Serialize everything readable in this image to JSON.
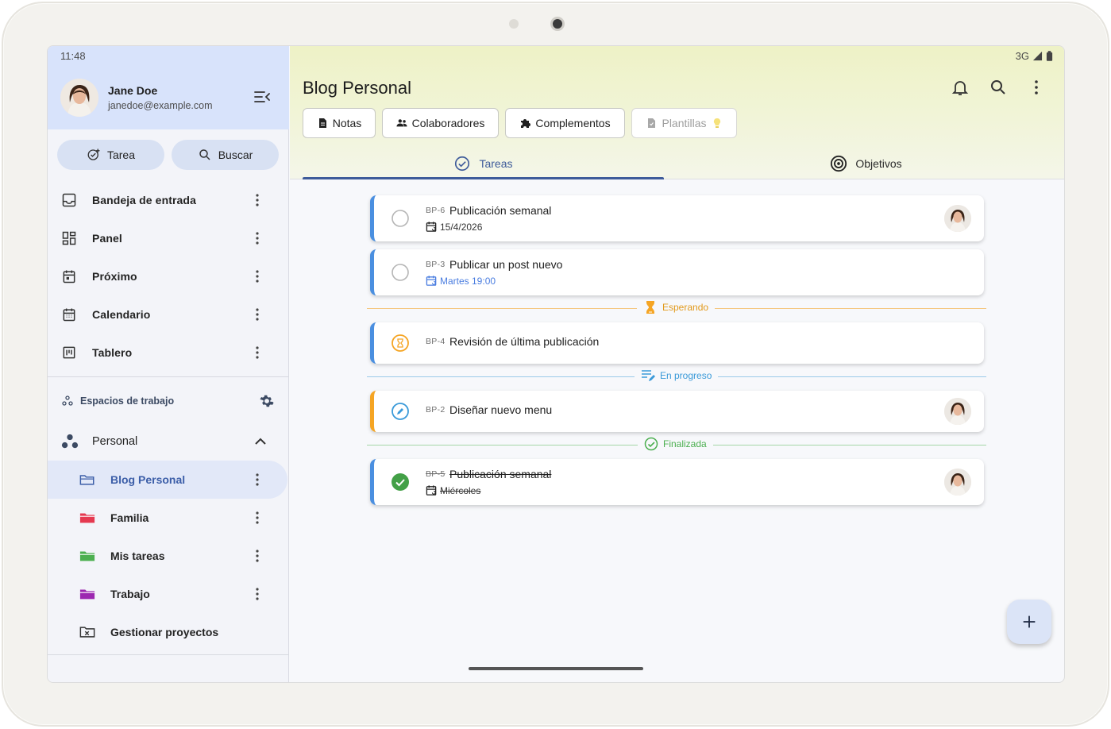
{
  "status_bar": {
    "time": "11:48",
    "network": "3G"
  },
  "user": {
    "name": "Jane Doe",
    "email": "janedoe@example.com"
  },
  "actions": {
    "task": "Tarea",
    "search": "Buscar"
  },
  "nav": [
    {
      "label": "Bandeja de entrada",
      "icon": "inbox-icon"
    },
    {
      "label": "Panel",
      "icon": "dashboard-icon"
    },
    {
      "label": "Próximo",
      "icon": "upcoming-icon"
    },
    {
      "label": "Calendario",
      "icon": "calendar-icon"
    },
    {
      "label": "Tablero",
      "icon": "board-icon"
    }
  ],
  "workspaces": {
    "header": "Espacios de trabajo",
    "current": "Personal"
  },
  "projects": [
    {
      "label": "Blog Personal",
      "color": "#3c5ea8",
      "active": true
    },
    {
      "label": "Familia",
      "color": "#e53950"
    },
    {
      "label": "Mis tareas",
      "color": "#4caf50"
    },
    {
      "label": "Trabajo",
      "color": "#9c27b0"
    }
  ],
  "manage_projects": "Gestionar proyectos",
  "header": {
    "title": "Blog Personal",
    "chips": [
      "Notas",
      "Colaboradores",
      "Complementos",
      "Plantillas"
    ],
    "tabs": [
      "Tareas",
      "Objetivos"
    ]
  },
  "tasks": [
    {
      "code": "BP-6",
      "title": "Publicación semanal",
      "date": "15/4/2026",
      "status": "todo",
      "accent": "#4a8fe0"
    },
    {
      "code": "BP-3",
      "title": "Publicar un post nuevo",
      "date": "Martes 19:00",
      "status": "todo",
      "accent": "#4a8fe0",
      "date_color": "#4a7de0"
    },
    {
      "code": "BP-4",
      "title": "Revisión de última publicación",
      "status": "waiting",
      "accent": "#4a8fe0"
    },
    {
      "code": "BP-2",
      "title": "Diseñar nuevo menu",
      "status": "in_progress",
      "accent": "#f5a524"
    },
    {
      "code": "BP-5",
      "title": "Publicación semanal",
      "date": "Miércoles",
      "status": "done",
      "accent": "#4a8fe0"
    }
  ],
  "groups": {
    "waiting": {
      "label": "Esperando",
      "color": "#f5a524"
    },
    "in_progress": {
      "label": "En progreso",
      "color": "#3a9ad9"
    },
    "done": {
      "label": "Finalizada",
      "color": "#4caf50"
    }
  }
}
